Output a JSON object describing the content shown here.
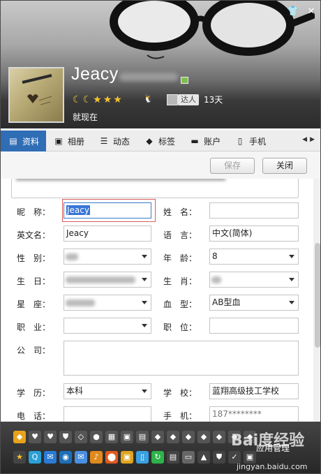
{
  "header": {
    "nickname": "Jeacy",
    "daren_label": "达人",
    "days": "13天",
    "status": "就现在",
    "levels": [
      "moon",
      "moon",
      "star",
      "star",
      "star"
    ]
  },
  "tabs": [
    {
      "label": "资料",
      "icon": "id-card-icon",
      "active": true
    },
    {
      "label": "相册",
      "icon": "photo-album-icon"
    },
    {
      "label": "动态",
      "icon": "feed-list-icon"
    },
    {
      "label": "标签",
      "icon": "tag-icon"
    },
    {
      "label": "账户",
      "icon": "wallet-icon"
    },
    {
      "label": "手机",
      "icon": "mobile-phone-icon"
    }
  ],
  "actions": {
    "save": "保存",
    "close": "关闭"
  },
  "form": {
    "nickname_label": "昵　称：",
    "nickname_value": "Jeacy",
    "name_label": "姓　名：",
    "name_value": "",
    "english_label": "英文名：",
    "english_value": "Jeacy",
    "language_label": "语　言：",
    "language_value": "中文(简体)",
    "gender_label": "性　别：",
    "age_label": "年　龄：",
    "age_value": "8",
    "birthday_label": "生　日：",
    "zodiac_label": "生　肖：",
    "constellation_label": "星　座：",
    "blood_label": "血　型：",
    "blood_value": "AB型血",
    "job_label": "职　业：",
    "position_label": "职　位：",
    "company_label": "公　司：",
    "education_label": "学　历：",
    "education_value": "本科",
    "school_label": "学　校：",
    "school_value": "蓝翔高级技工学校",
    "phone_label": "电　话：",
    "mobile_label": "手　机：",
    "mobile_value": "187********"
  },
  "bottom": {
    "management": "应用管理",
    "watermark": "Bai度经验",
    "watermark_url": "jingyan.baidu.com"
  },
  "colors": {
    "tab_active": "#2f6db5",
    "focus_border": "#d95b5b",
    "selection": "#3875d7"
  }
}
